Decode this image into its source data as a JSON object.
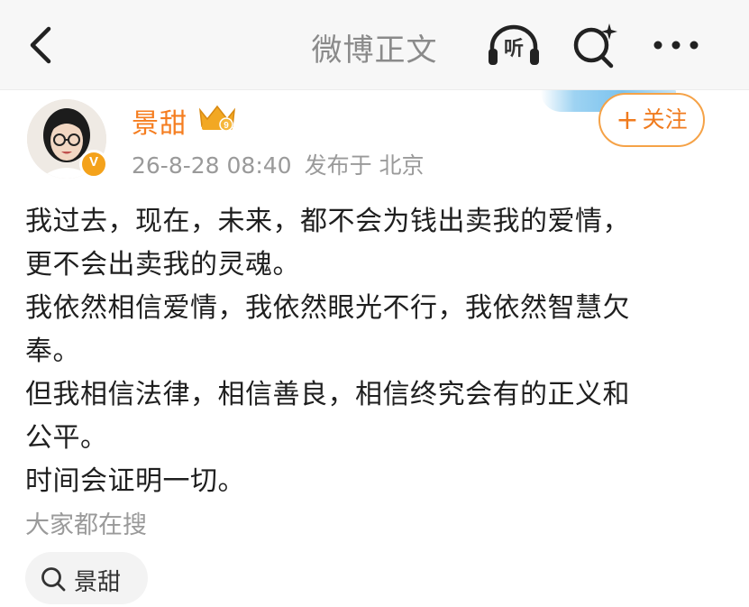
{
  "nav": {
    "title": "微博正文",
    "listen_label": "听",
    "icons": {
      "back": "chevron-left-icon",
      "listen": "headphones-icon",
      "search": "search-sparkle-icon",
      "more": "more-dots-icon"
    }
  },
  "author": {
    "name": "景甜",
    "badge": "crown-vip-icon",
    "verified_badge": "V",
    "timestamp": "26-8-28 08:40",
    "location": "发布于 北京",
    "follow_label": "关注",
    "follow_plus": "+"
  },
  "post": {
    "lines": [
      "我过去，现在，未来，都不会为钱出卖我的爱情，",
      "更不会出卖我的灵魂。",
      "我依然相信爱情，我依然眼光不行，我依然智慧欠",
      "奉。",
      "但我相信法律，相信善良，相信终究会有的正义和",
      "公平。",
      "时间会证明一切。"
    ]
  },
  "suggestions": {
    "label": "大家都在搜",
    "items": [
      {
        "text": "景甜"
      }
    ]
  },
  "colors": {
    "accent": "#f57d1f",
    "follow_border": "#f5a247",
    "text_primary": "#1f1f1f",
    "text_secondary": "#9a9a9a",
    "topbar_bg": "#f7f7f7",
    "banner_blue": "#9ed3f2"
  }
}
